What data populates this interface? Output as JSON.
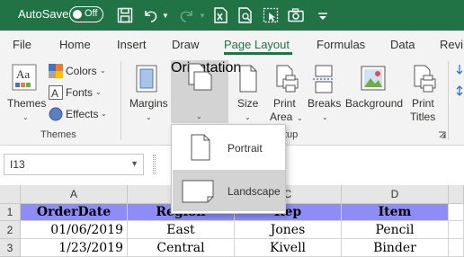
{
  "titlebar": {
    "autosave_label": "AutoSave",
    "toggle_state": "Off"
  },
  "tabs": [
    "File",
    "Home",
    "Insert",
    "Draw",
    "Page Layout",
    "Formulas",
    "Data",
    "Revi"
  ],
  "active_tab": "Page Layout",
  "ribbon": {
    "themes_label": "Themes",
    "colors_label": "Colors",
    "fonts_label": "Fonts",
    "effects_label": "Effects",
    "themes_group_label": "Themes",
    "margins_label": "Margins",
    "orientation_label": "Orientation",
    "size_label": "Size",
    "print_area_line1": "Print",
    "print_area_line2": "Area",
    "breaks_label": "Breaks",
    "background_label": "Background",
    "print_titles_line1": "Print",
    "print_titles_line2": "Titles",
    "page_setup_group_label_partial": "tup"
  },
  "namebox": {
    "value": "I13"
  },
  "orientation_menu": {
    "items": [
      "Portrait",
      "Landscape"
    ],
    "selected": "Landscape"
  },
  "sheet": {
    "columns": [
      "A",
      "B",
      "C",
      "D"
    ],
    "rows": [
      {
        "num": "1",
        "cells": [
          "OrderDate",
          "Region",
          "Rep",
          "Item"
        ]
      },
      {
        "num": "2",
        "cells": [
          "01/06/2019",
          "East",
          "Jones",
          "Pencil"
        ]
      },
      {
        "num": "3",
        "cells": [
          "1/23/2019",
          "Central",
          "Kivell",
          "Binder"
        ]
      }
    ]
  },
  "colors": {
    "excel_green": "#217346",
    "header_fill": "#8d8df5"
  }
}
